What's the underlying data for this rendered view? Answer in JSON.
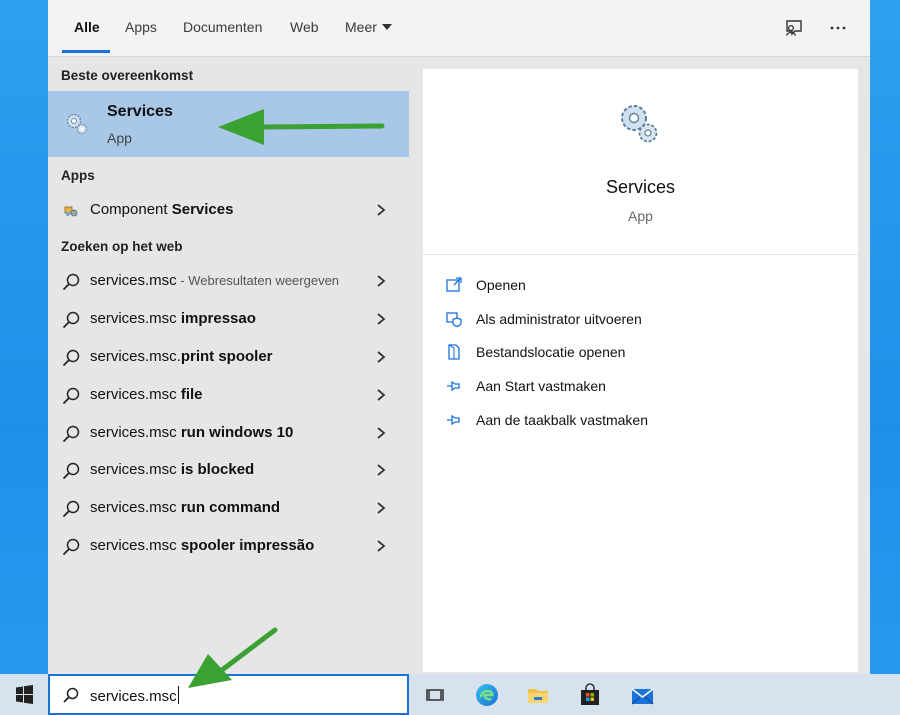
{
  "tabs": {
    "items": [
      {
        "label": "Alle",
        "active": true
      },
      {
        "label": "Apps"
      },
      {
        "label": "Documenten"
      },
      {
        "label": "Web"
      },
      {
        "label": "Meer"
      }
    ],
    "feedback_icon": "feedback-icon",
    "more_icon": "ellipsis-icon"
  },
  "best_match": {
    "section_label": "Beste overeenkomst",
    "title": "Services",
    "subtitle": "App",
    "icon": "gears-icon"
  },
  "apps": {
    "section_label": "Apps",
    "items": [
      {
        "text": "Component ",
        "highlight": "Services",
        "icon": "component-services-icon"
      }
    ]
  },
  "web": {
    "section_label": "Zoeken op het web",
    "items": [
      {
        "text": "services.msc",
        "muted": " - Webresultaten weergeven",
        "highlight": ""
      },
      {
        "text": "services.msc ",
        "highlight": "impressao"
      },
      {
        "text": "services.msc.",
        "highlight": "print spooler"
      },
      {
        "text": "services.msc ",
        "highlight": "file"
      },
      {
        "text": "services.msc ",
        "highlight": "run windows 10"
      },
      {
        "text": "services.msc ",
        "highlight": "is blocked"
      },
      {
        "text": "services.msc ",
        "highlight": "run command"
      },
      {
        "text": "services.msc ",
        "highlight": "spooler impressão"
      }
    ]
  },
  "detail": {
    "title": "Services",
    "subtitle": "App",
    "actions": [
      {
        "label": "Openen",
        "icon": "open-icon"
      },
      {
        "label": "Als administrator uitvoeren",
        "icon": "admin-shield-icon"
      },
      {
        "label": "Bestandslocatie openen",
        "icon": "file-location-icon"
      },
      {
        "label": "Aan Start vastmaken",
        "icon": "pin-icon"
      },
      {
        "label": "Aan de taakbalk vastmaken",
        "icon": "pin-icon"
      }
    ]
  },
  "taskbar": {
    "search_value": "services.msc",
    "icons": [
      "windows-start-icon",
      "task-view-icon",
      "edge-icon",
      "file-explorer-icon",
      "store-icon",
      "mail-icon"
    ]
  },
  "colors": {
    "accent": "#1a73d9",
    "selected_row": "#a9c8e8",
    "annotation_arrow": "#3aa132"
  }
}
